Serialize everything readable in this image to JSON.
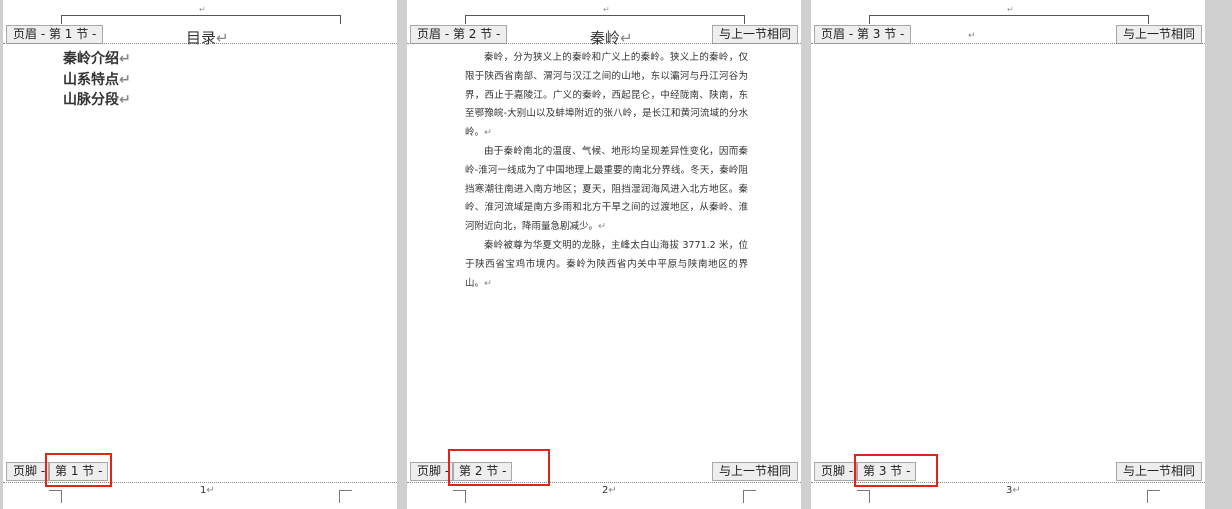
{
  "pages": [
    {
      "header_tab": "页眉 - 第 1 节 -",
      "title": "目录",
      "toc": [
        "秦岭介绍",
        "山系特点",
        "山脉分段"
      ],
      "footer_label": "页脚 -",
      "footer_section": "第 1 节 -",
      "page_number": "1"
    },
    {
      "header_tab": "页眉 - 第 2 节 -",
      "header_same": "与上一节相同",
      "title": "秦岭",
      "paragraphs": [
        "秦岭，分为狭义上的秦岭和广义上的秦岭。狭义上的秦岭，仅限于陕西省南部、渭河与汉江之间的山地，东以灞河与丹江河谷为界，西止于嘉陵江。广义的秦岭，西起昆仑，中经陇南、陕南，东至鄂豫皖-大别山以及蚌埠附近的张八岭，是长江和黄河流域的分水岭。",
        "由于秦岭南北的温度、气候、地形均呈现差异性变化，因而秦岭-淮河一线成为了中国地理上最重要的南北分界线。冬天，秦岭阻挡寒潮往南进入南方地区；夏天，阻挡湿润海风进入北方地区。秦岭、淮河流域是南方多雨和北方干旱之间的过渡地区，从秦岭、淮河附近向北，降雨量急剧减少。",
        "秦岭被尊为华夏文明的龙脉，主峰太白山海拔 3771.2 米，位于陕西省宝鸡市境内。秦岭为陕西省内关中平原与陕南地区的界山。"
      ],
      "footer_label": "页脚 -",
      "footer_section": "第 2 节 -",
      "footer_same": "与上一节相同",
      "page_number": "2"
    },
    {
      "header_tab": "页眉 - 第 3 节 -",
      "header_same": "与上一节相同",
      "footer_label": "页脚 -",
      "footer_section": "第 3 节 -",
      "footer_same": "与上一节相同",
      "page_number": "3"
    }
  ],
  "glyphs": {
    "paragraph_mark": "↵"
  },
  "colors": {
    "highlight_box": "#e2231a",
    "tab_bg": "#eeeeee",
    "workspace": "#d0d0d0"
  }
}
